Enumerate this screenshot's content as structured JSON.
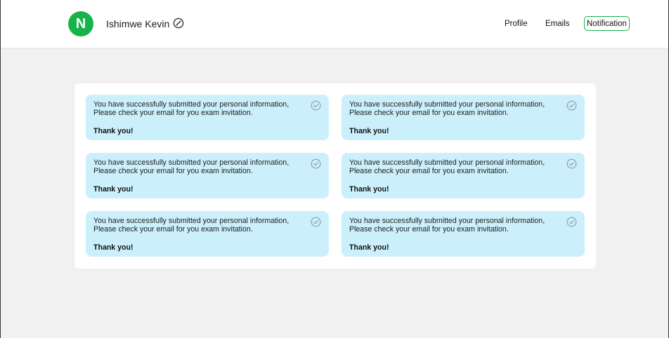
{
  "header": {
    "avatar_initial": "N",
    "user_name": "Ishimwe Kevin",
    "edit_icon": "edit-icon",
    "nav": {
      "profile": "Profile",
      "emails": "Emails",
      "notification": "Notification"
    }
  },
  "colors": {
    "accent": "#17b34a",
    "card_background": "#ccf0fb",
    "page_background": "#f1f1f1"
  },
  "notifications": [
    {
      "message": "You have successfully submitted your personal information, Please check your email for you exam invitation.",
      "thanks": "Thank you!",
      "icon": "check-circle-icon"
    },
    {
      "message": "You have successfully submitted your personal information, Please check your email for you exam invitation.",
      "thanks": "Thank you!",
      "icon": "check-circle-icon"
    },
    {
      "message": "You have successfully submitted your personal information, Please check your email for you exam invitation.",
      "thanks": "Thank you!",
      "icon": "check-circle-icon"
    },
    {
      "message": "You have successfully submitted your personal information, Please check your email for you exam invitation.",
      "thanks": "Thank you!",
      "icon": "check-circle-icon"
    },
    {
      "message": "You have successfully submitted your personal information, Please check your email for you exam invitation.",
      "thanks": "Thank you!",
      "icon": "check-circle-icon"
    },
    {
      "message": "You have successfully submitted your personal information, Please check your email for you exam invitation.",
      "thanks": "Thank you!",
      "icon": "check-circle-icon"
    }
  ]
}
